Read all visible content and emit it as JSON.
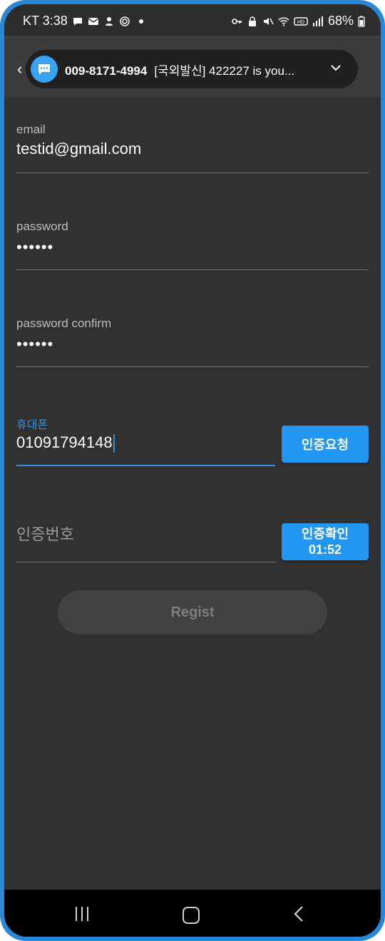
{
  "status_bar": {
    "carrier_time": "KT 3:38",
    "battery": "68%"
  },
  "notification": {
    "sender": "009-8171-4994",
    "message": "[국외발신] 422227 is you..."
  },
  "form": {
    "email": {
      "label": "email",
      "value": "testid@gmail.com"
    },
    "password": {
      "label": "password",
      "value": "••••••"
    },
    "password_confirm": {
      "label": "password confirm",
      "value": "••••••"
    },
    "phone": {
      "label": "휴대폰",
      "value": "01091794148"
    },
    "request_button": "인증요청",
    "code": {
      "placeholder": "인증번호"
    },
    "confirm_button": {
      "label": "인증확인",
      "timer": "01:52"
    },
    "regist_button": "Regist"
  },
  "colors": {
    "accent": "#2196f3",
    "background": "#313131",
    "frame": "#2a86d6"
  },
  "icons": [
    "chat-bubble-icon",
    "mail-icon",
    "status-icons",
    "key-icon",
    "wifi-icon",
    "signal-icon",
    "battery-icon",
    "chevron-down-icon",
    "recent-apps-icon",
    "home-icon",
    "back-icon"
  ]
}
